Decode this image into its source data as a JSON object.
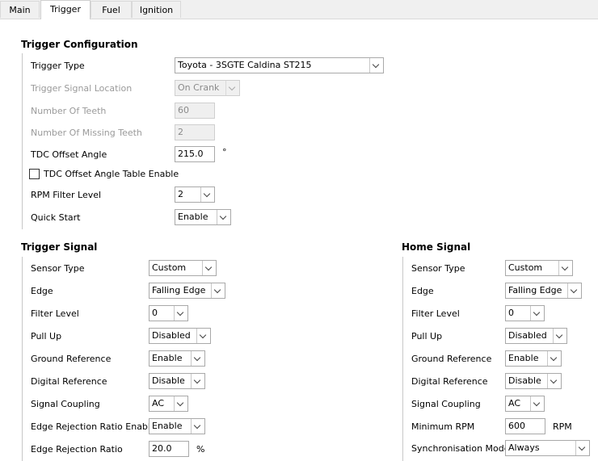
{
  "tabs": [
    "Main",
    "Trigger",
    "Fuel",
    "Ignition"
  ],
  "trigger_config": {
    "title": "Trigger Configuration",
    "trigger_type": {
      "label": "Trigger Type",
      "value": "Toyota - 3SGTE Caldina ST215"
    },
    "trigger_signal_location": {
      "label": "Trigger Signal Location",
      "value": "On Crank"
    },
    "number_of_teeth": {
      "label": "Number Of Teeth",
      "value": "60"
    },
    "number_of_missing_teeth": {
      "label": "Number Of Missing Teeth",
      "value": "2"
    },
    "tdc_offset_angle": {
      "label": "TDC Offset Angle",
      "value": "215.0",
      "unit": "°"
    },
    "tdc_table_enable": {
      "label": "TDC Offset Angle Table Enable",
      "checked": false
    },
    "rpm_filter_level": {
      "label": "RPM Filter Level",
      "value": "2"
    },
    "quick_start": {
      "label": "Quick Start",
      "value": "Enable"
    }
  },
  "trigger_signal": {
    "title": "Trigger Signal",
    "sensor_type": {
      "label": "Sensor Type",
      "value": "Custom"
    },
    "edge": {
      "label": "Edge",
      "value": "Falling Edge"
    },
    "filter_level": {
      "label": "Filter Level",
      "value": "0"
    },
    "pull_up": {
      "label": "Pull Up",
      "value": "Disabled"
    },
    "ground_reference": {
      "label": "Ground Reference",
      "value": "Enable"
    },
    "digital_reference": {
      "label": "Digital Reference",
      "value": "Disable"
    },
    "signal_coupling": {
      "label": "Signal Coupling",
      "value": "AC"
    },
    "edge_rejection_enable": {
      "label": "Edge Rejection Ratio Enable",
      "value": "Enable"
    },
    "edge_rejection_ratio": {
      "label": "Edge Rejection Ratio",
      "value": "20.0",
      "unit": "%"
    }
  },
  "home_signal": {
    "title": "Home Signal",
    "sensor_type": {
      "label": "Sensor Type",
      "value": "Custom"
    },
    "edge": {
      "label": "Edge",
      "value": "Falling Edge"
    },
    "filter_level": {
      "label": "Filter Level",
      "value": "0"
    },
    "pull_up": {
      "label": "Pull Up",
      "value": "Disabled"
    },
    "ground_reference": {
      "label": "Ground Reference",
      "value": "Enable"
    },
    "digital_reference": {
      "label": "Digital Reference",
      "value": "Disable"
    },
    "signal_coupling": {
      "label": "Signal Coupling",
      "value": "AC"
    },
    "minimum_rpm": {
      "label": "Minimum RPM",
      "value": "600",
      "unit": "RPM"
    },
    "synchronisation_mode": {
      "label": "Synchronisation Mode",
      "value": "Always"
    }
  }
}
